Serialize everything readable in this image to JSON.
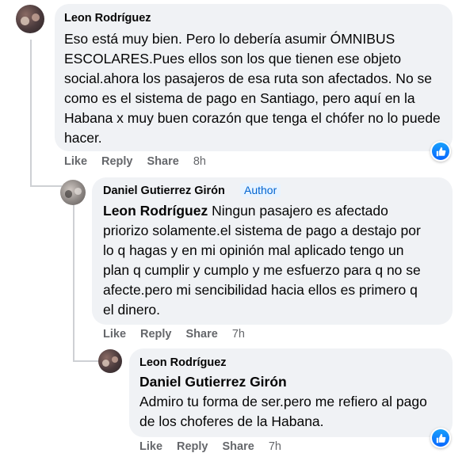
{
  "comments": [
    {
      "author": "Leon Rodríguez",
      "mention": "",
      "text": "Eso está muy bien. Pero lo debería asumir ÓMNIBUS ESCOLARES.Pues ellos son los que tienen ese objeto social.ahora los pasajeros de esa ruta son afectados. No se como es el sistema de pago en Santiago, pero aquí en la Habana x muy buen corazón que tenga el chófer no lo puede hacer.",
      "like": "Like",
      "reply": "Reply",
      "share": "Share",
      "time": "8h"
    },
    {
      "author": "Daniel Gutierrez Girón",
      "badge": "Author",
      "mention": "Leon Rodríguez",
      "text": " Ningun pasajero es afectado priorizo solamente.el sistema de pago a destajo por lo q hagas y en mi opinión mal aplicado tengo un plan q cumplir y cumplo y me esfuerzo para q no se afecte.pero mi sencibilidad hacia ellos es primero q el dinero.",
      "like": "Like",
      "reply": "Reply",
      "share": "Share",
      "time": "7h"
    },
    {
      "author": "Leon Rodríguez",
      "mention": "Daniel Gutierrez Girón",
      "text": "Admiro tu forma de ser.pero me refiero al pago de los choferes de la Habana.",
      "like": "Like",
      "reply": "Reply",
      "share": "Share",
      "time": "7h"
    }
  ],
  "icons": {
    "reaction": "like-thumbs-up-icon"
  },
  "colors": {
    "bubble": "#f0f2f5",
    "reaction_blue": "#0866ff",
    "author_badge_bg": "#e7f3ff",
    "author_badge_text": "#0064d1"
  }
}
